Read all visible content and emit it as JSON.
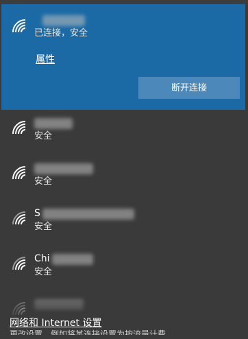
{
  "connected_network": {
    "name": "",
    "status": "已连接，安全",
    "properties_link": "属性",
    "disconnect_label": "断开连接"
  },
  "networks": [
    {
      "name": "",
      "status": "安全"
    },
    {
      "name": "",
      "status": "安全"
    },
    {
      "name": "S",
      "status": "安全"
    },
    {
      "name": "Chi",
      "status": "安全"
    },
    {
      "name": "",
      "status": ""
    }
  ],
  "footer": {
    "settings_link": "网络和 Internet 设置",
    "sub_text": "更改设置，例如将某连接设置为按流量计费。"
  },
  "colors": {
    "panel_bg": "#3a3a3a",
    "connected_bg": "#1b6aa6",
    "button_bg": "#4d88bb"
  },
  "icons": {
    "wifi": "wifi-signal-icon",
    "wifi_secured": "wifi-signal-icon"
  }
}
